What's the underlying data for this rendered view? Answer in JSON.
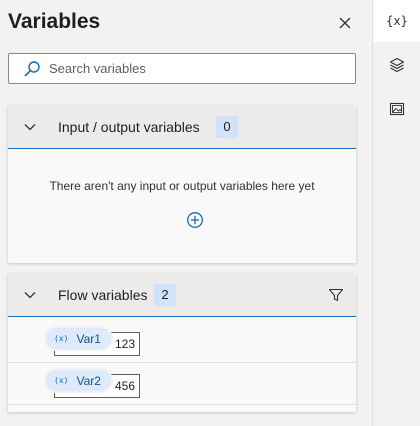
{
  "panel": {
    "title": "Variables",
    "search_placeholder": "Search variables"
  },
  "io_section": {
    "title": "Input / output variables",
    "count": "0",
    "empty_message": "There aren't any input or output variables here yet"
  },
  "flow_section": {
    "title": "Flow variables",
    "count": "2",
    "variables": [
      {
        "name": "Var1",
        "value": "123",
        "type_icon": "(x)"
      },
      {
        "name": "Var2",
        "value": "456",
        "type_icon": "(x)"
      }
    ]
  },
  "rail": {
    "variables_label": "{x}",
    "items": [
      "variables-icon",
      "layers-icon",
      "image-icon"
    ]
  },
  "colors": {
    "accent": "#0f6cbd",
    "badge_bg": "#cfe4fa",
    "pill_bg": "#dceafb",
    "panel_bg": "#f3f2f1"
  }
}
